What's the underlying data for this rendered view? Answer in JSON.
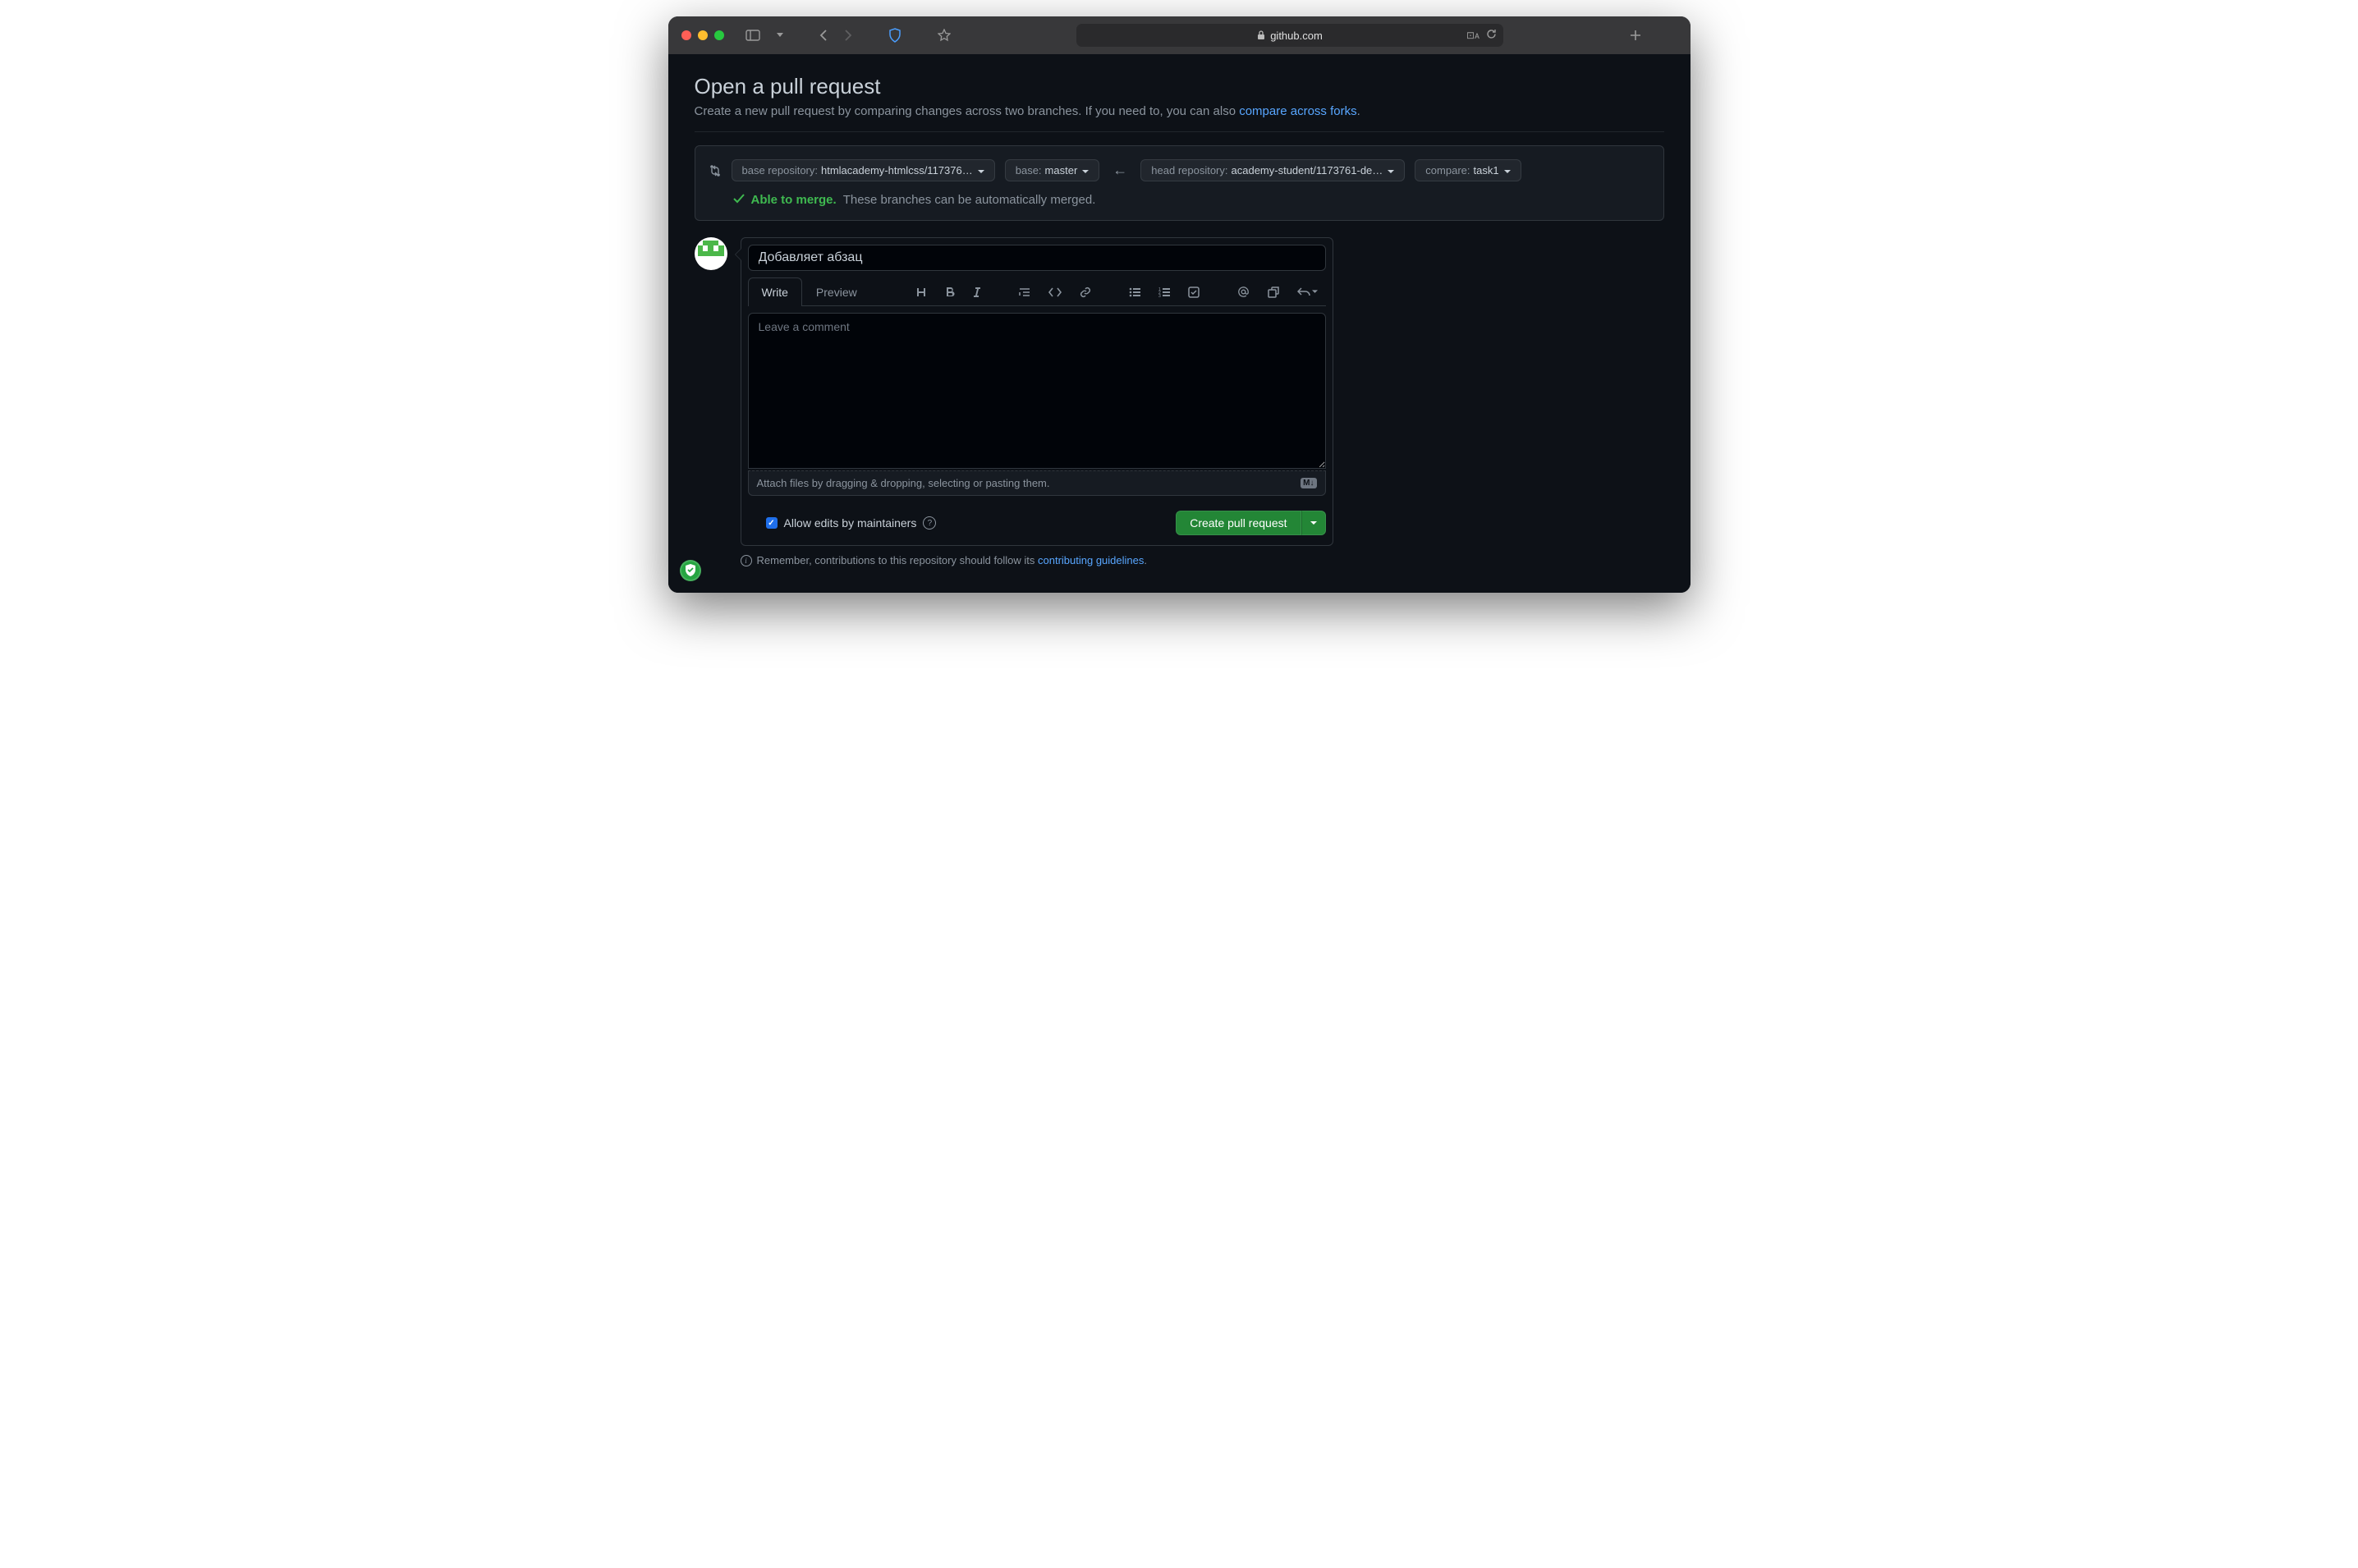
{
  "browser": {
    "url_host": "github.com"
  },
  "page": {
    "title": "Open a pull request",
    "description_prefix": "Create a new pull request by comparing changes across two branches. If you need to, you can also ",
    "description_link": "compare across forks",
    "description_suffix": "."
  },
  "compare": {
    "base_repo_label": "base repository: ",
    "base_repo_value": "htmlacademy-htmlcss/117376…",
    "base_label": "base: ",
    "base_value": "master",
    "head_repo_label": "head repository: ",
    "head_repo_value": "academy-student/1173761-de…",
    "compare_label": "compare: ",
    "compare_value": "task1"
  },
  "merge": {
    "able_text": "Able to merge.",
    "message": "These branches can be automatically merged."
  },
  "form": {
    "title_value": "Добавляет абзац",
    "tab_write": "Write",
    "tab_preview": "Preview",
    "comment_placeholder": "Leave a comment",
    "attach_hint": "Attach files by dragging & dropping, selecting or pasting them.",
    "md_badge": "M↓",
    "allow_edits_label": "Allow edits by maintainers",
    "create_button": "Create pull request"
  },
  "guidelines": {
    "prefix": "Remember, contributions to this repository should follow its ",
    "link_text": "contributing guidelines",
    "suffix": "."
  }
}
